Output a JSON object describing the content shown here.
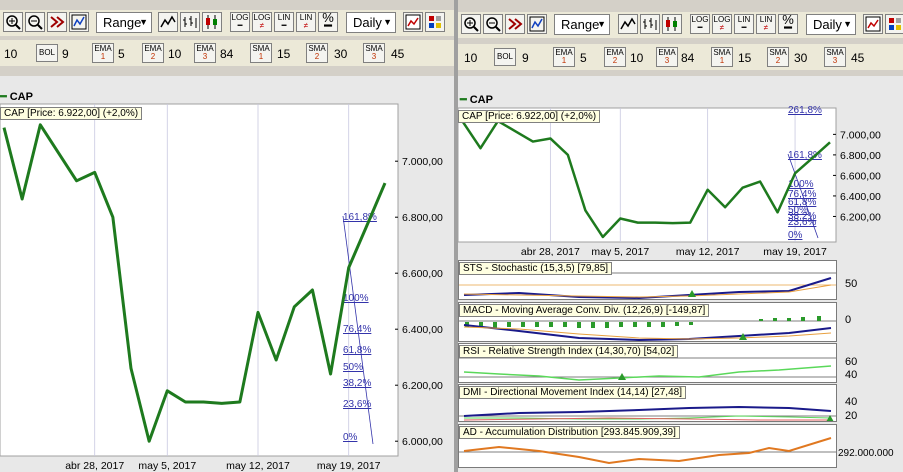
{
  "toolbar": {
    "range_label": "Range",
    "period_label": "Daily",
    "icon_labels": {
      "log": "LOG",
      "log_ne": "LOG",
      "lin": "LIN",
      "lin_ne": "LIN",
      "pct": "%"
    }
  },
  "indicator_bar": {
    "items": [
      {
        "value": "10"
      },
      {
        "label": "BOL",
        "value": "9"
      },
      {
        "label": "EMA",
        "index": "1",
        "value": "5"
      },
      {
        "label": "EMA",
        "index": "2",
        "value": "10"
      },
      {
        "label": "EMA",
        "index": "3",
        "value": "84"
      },
      {
        "label": "SMA",
        "index": "1",
        "value": "15"
      },
      {
        "label": "SMA",
        "index": "2",
        "value": "30"
      },
      {
        "label": "SMA",
        "index": "3",
        "value": "45"
      }
    ]
  },
  "colors": {
    "price_line": "#1e7a1e",
    "fib": "#3333aa",
    "macd": "#1a1a8a",
    "signal": "#e8a040",
    "ad": "#e07820"
  },
  "left_chart": {
    "legend": "CAP",
    "info": "CAP [Price: 6.922,00] (+2,0%)",
    "fib_labels": [
      "161,8%",
      "100%",
      "76,4%",
      "61,8%",
      "50%",
      "38,2%",
      "23,6%",
      "0%"
    ],
    "y_labels": [
      "7.000,00",
      "6.800,00",
      "6.600,00",
      "6.400,00",
      "6.200,00",
      "6.000,00"
    ],
    "x_labels": [
      "abr 28, 2017",
      "may 5, 2017",
      "may 12, 2017",
      "may 19, 2017"
    ]
  },
  "right_chart": {
    "legend": "CAP",
    "info": "CAP [Price: 6.922,00] (+2,0%)",
    "fib_labels": [
      "261,8%",
      "161,8%",
      "100%",
      "76,4%",
      "61,8%",
      "50%",
      "38,2%",
      "23,6%",
      "0%"
    ],
    "y_labels": [
      "7.000,00",
      "6.800,00",
      "6.600,00",
      "6.400,00",
      "6.200,00"
    ],
    "x_labels": [
      "abr 28, 2017",
      "may 5, 2017",
      "may 12, 2017",
      "may 19, 2017"
    ]
  },
  "indicators": [
    {
      "title": "STS - Stochastic (15,3,5) [79,85]",
      "scale": [
        "50"
      ]
    },
    {
      "title": "MACD - Moving Average Conv. Div. (12,26,9) [-149,87]",
      "scale": [
        "0"
      ]
    },
    {
      "title": "RSI - Relative Strength Index (14,30,70) [54,02]",
      "scale": [
        "60",
        "40"
      ]
    },
    {
      "title": "DMI - Directional Movement Index (14,14) [27,48]",
      "scale": [
        "40",
        "20"
      ]
    },
    {
      "title": "AD - Accumulation Distribution [293.845.909,39]",
      "scale": [
        "292.000.000"
      ]
    }
  ],
  "chart_data": {
    "type": "line",
    "series": [
      {
        "name": "CAP",
        "values": [
          7120,
          6865,
          7130,
          7030,
          6930,
          6960,
          6800,
          6260,
          6000,
          6180,
          6140,
          6140,
          6135,
          6140,
          6460,
          6290,
          6480,
          6540,
          6240,
          6620,
          6770,
          6922
        ]
      }
    ],
    "ylim": [
      5990,
      7140
    ]
  }
}
